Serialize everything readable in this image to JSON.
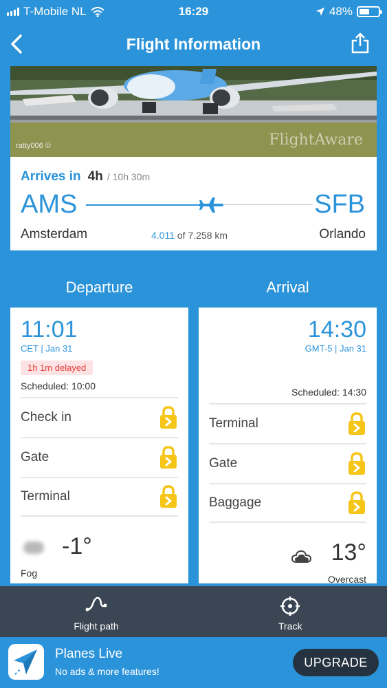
{
  "status_bar": {
    "carrier": "T-Mobile NL",
    "time": "16:29",
    "battery": "48%"
  },
  "nav": {
    "title": "Flight Information",
    "back_icon": "chevron-left-icon",
    "share_icon": "share-icon"
  },
  "photo": {
    "credit": "ratty006 ©",
    "watermark": "FlightAware"
  },
  "route": {
    "arrives_label": "Arrives in",
    "arrives_value": "4h",
    "total_duration": "/ 10h 30m",
    "from_code": "AMS",
    "to_code": "SFB",
    "from_city": "Amsterdam",
    "to_city": "Orlando",
    "distance_done": "4.011",
    "distance_total": "of 7.258 km",
    "progress_fraction": 0.55
  },
  "departure": {
    "header": "Departure",
    "time": "11:01",
    "tz_date": "CET | Jan 31",
    "delay": "1h 1m delayed",
    "scheduled": "Scheduled: 10:00",
    "rows": [
      "Check in",
      "Gate",
      "Terminal"
    ],
    "temperature": "-1°",
    "weather": "Fog",
    "weather_icon": "fog-icon"
  },
  "arrival": {
    "header": "Arrival",
    "time": "14:30",
    "tz_date": "GMT-5 | Jan 31",
    "scheduled": "Scheduled: 14:30",
    "rows": [
      "Terminal",
      "Gate",
      "Baggage"
    ],
    "temperature": "13°",
    "weather": "Overcast",
    "weather_icon": "cloud-icon"
  },
  "toolbar": {
    "flight_path": "Flight path",
    "track": "Track"
  },
  "promo": {
    "app_name": "Planes Live",
    "subtitle": "No ads & more features!",
    "upgrade": "UPGRADE"
  },
  "colors": {
    "accent": "#2b93d9",
    "toolbar": "#3a4653",
    "lock": "#f5c518",
    "delay_bg": "#fde3e3",
    "delay_text": "#e43d3d"
  }
}
